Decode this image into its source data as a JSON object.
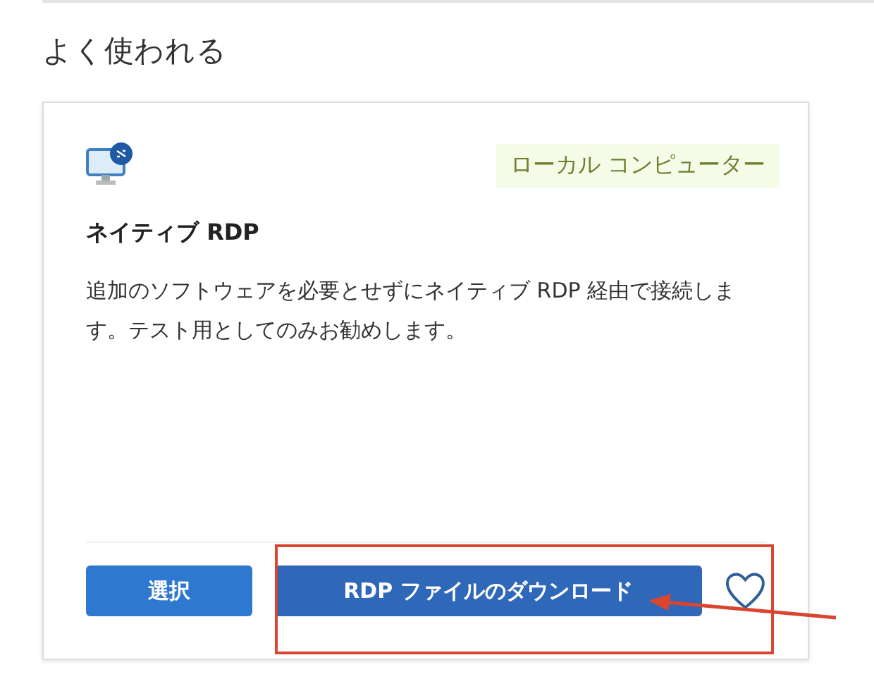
{
  "section": {
    "title": "よく使われる"
  },
  "card": {
    "tag": "ローカル コンピューター",
    "title": "ネイティブ RDP",
    "description": "追加のソフトウェアを必要とせずにネイティブ RDP 経由で接続します。テスト用としてのみお勧めします。",
    "buttons": [
      {
        "label": "選択"
      },
      {
        "label": "RDP ファイルのダウンロード"
      }
    ]
  }
}
